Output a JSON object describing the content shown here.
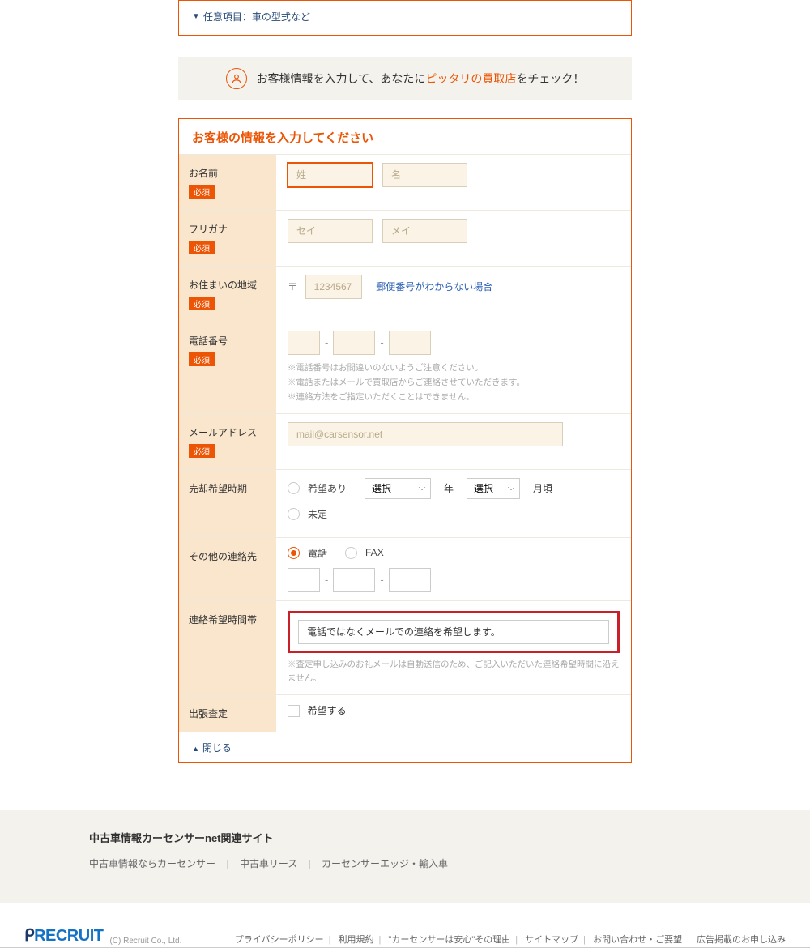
{
  "top_collapse": "任意項目：車の型式など",
  "banner": {
    "pre": "お客様情報を入力して、あなたに",
    "highlight": "ピッタリの買取店",
    "post": "をチェック！"
  },
  "form": {
    "title": "お客様の情報を入力してください",
    "required_badge": "必須",
    "name": {
      "label": "お名前",
      "sei_ph": "姓",
      "mei_ph": "名"
    },
    "kana": {
      "label": "フリガナ",
      "sei_ph": "セイ",
      "mei_ph": "メイ"
    },
    "region": {
      "label": "お住まいの地域",
      "prefix": "〒",
      "zip_ph": "1234567",
      "unknown_link": "郵便番号がわからない場合"
    },
    "tel": {
      "label": "電話番号",
      "note1": "※電話番号はお間違いのないようご注意ください。",
      "note2": "※電話またはメールで買取店からご連絡させていただきます。",
      "note3": "※連絡方法をご指定いただくことはできません。"
    },
    "email": {
      "label": "メールアドレス",
      "ph": "mail@carsensor.net"
    },
    "sale_time": {
      "label": "売却希望時期",
      "opt_has": "希望あり",
      "opt_none": "未定",
      "select_ph": "選択",
      "year_suffix": "年",
      "month_suffix": "月頃"
    },
    "other_contact": {
      "label": "その他の連絡先",
      "tel_opt": "電話",
      "fax_opt": "FAX"
    },
    "contact_wish": {
      "label": "連絡希望時間帯",
      "value": "電話ではなくメールでの連絡を希望します。",
      "note1": "※査定申し込みのお礼メールは自動送信のため、ご記入いただいた連絡希望時間に沿えません。"
    },
    "onsite": {
      "label": "出張査定",
      "opt": "希望する"
    },
    "close": "閉じる"
  },
  "related": {
    "title": "中古車情報カーセンサーnet関連サイト",
    "links": [
      "中古車情報ならカーセンサー",
      "中古車リース",
      "カーセンサーエッジ・輸入車"
    ]
  },
  "footer": {
    "logo": "RECRUIT",
    "co": "(C) Recruit Co., Ltd.",
    "links": [
      "プライバシーポリシー",
      "利用規約",
      "\"カーセンサーは安心\"その理由",
      "サイトマップ",
      "お問い合わせ・ご要望",
      "広告掲載のお申し込み"
    ]
  }
}
